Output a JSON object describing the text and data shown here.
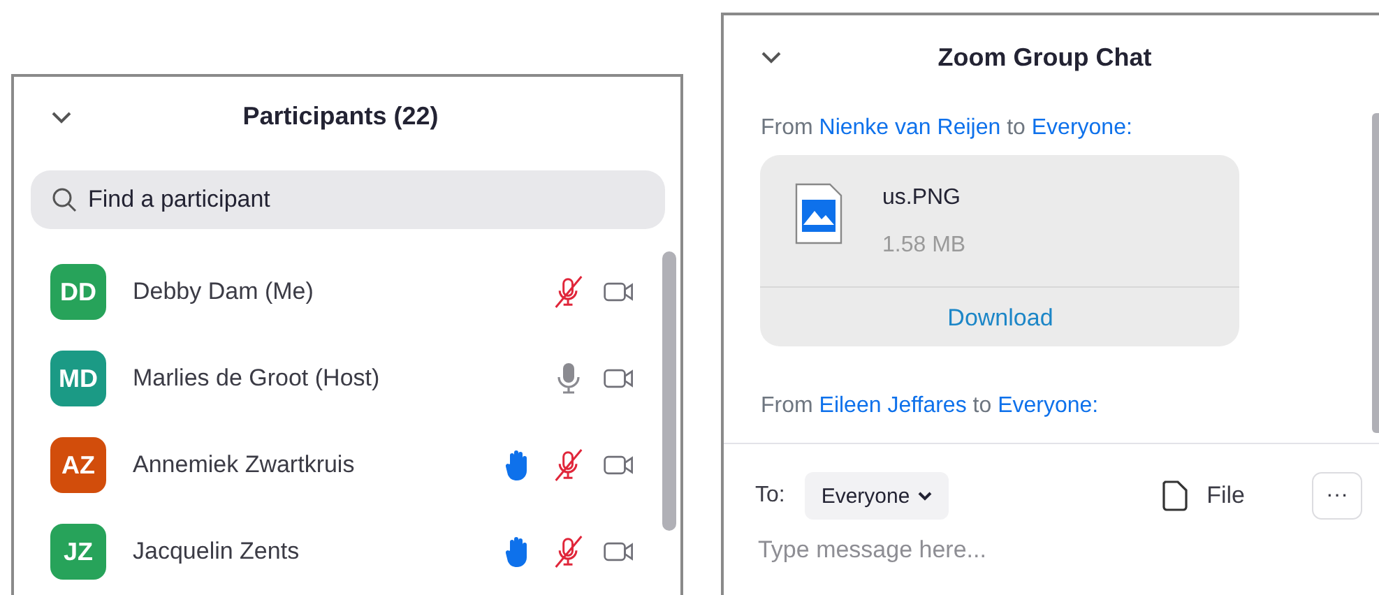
{
  "participants_panel": {
    "title": "Participants (22)",
    "search": {
      "placeholder": "Find a participant"
    },
    "participants": [
      {
        "initials": "DD",
        "name": "Debby Dam (Me)",
        "color": "#27a35a",
        "hand_raised": false,
        "mic_muted": true
      },
      {
        "initials": "MD",
        "name": "Marlies de Groot (Host)",
        "color": "#1b9a85",
        "hand_raised": false,
        "mic_muted": false
      },
      {
        "initials": "AZ",
        "name": "Annemiek Zwartkruis",
        "color": "#d24d0b",
        "hand_raised": true,
        "mic_muted": true
      },
      {
        "initials": "JZ",
        "name": "Jacquelin Zents",
        "color": "#27a35a",
        "hand_raised": true,
        "mic_muted": true
      }
    ]
  },
  "chat_panel": {
    "title": "Zoom Group Chat",
    "messages": [
      {
        "prefix": "From",
        "sender": "Nienke van Reijen",
        "joiner": "to",
        "recipient": "Everyone:",
        "attachment": {
          "file_name": "us.PNG",
          "size": "1.58 MB",
          "action": "Download"
        }
      },
      {
        "prefix": "From",
        "sender": "Eileen Jeffares",
        "joiner": "to",
        "recipient": "Everyone:"
      }
    ],
    "composer": {
      "to_label": "To:",
      "recipient": "Everyone",
      "file_label": "File",
      "more": "···",
      "placeholder": "Type message here..."
    }
  }
}
